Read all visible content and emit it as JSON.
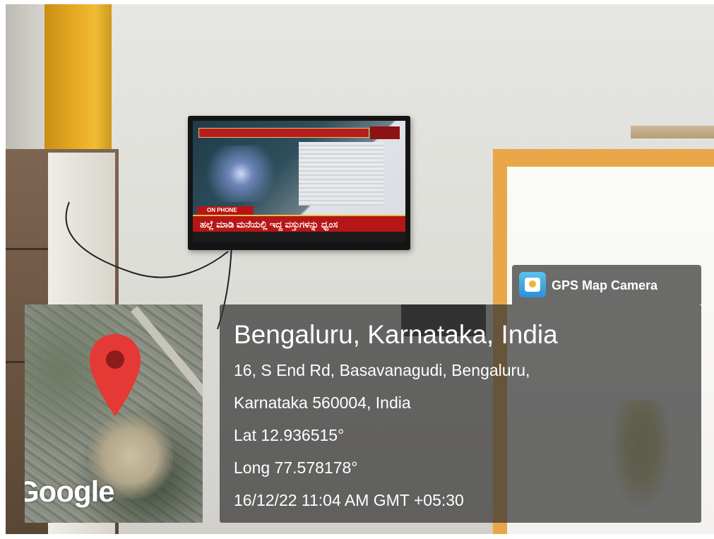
{
  "overlay": {
    "app_name": "GPS Map Camera",
    "app_icon": "gps-map-camera-icon",
    "map_attribution": "Google",
    "location_title": "Bengaluru, Karnataka, India",
    "address_line_1": "16, S End Rd, Basavanagudi, Bengaluru,",
    "address_line_2": "Karnataka 560004, India",
    "latitude": "Lat 12.936515°",
    "longitude": "Long 77.578178°",
    "datetime": "16/12/22 11:04 AM GMT +05:30"
  },
  "scene": {
    "tv_ticker_text": "ಹಲ್ಲೆ ಮಾಡಿ ಮನೆಯಲ್ಲಿ ಇದ್ದ ವಸ್ತುಗಳನ್ನು ಧ್ವಂಸ",
    "tv_caller_label": "ON PHONE",
    "colors": {
      "wall": "#dcdcd7",
      "pillar_yellow": "#e6aa22",
      "window_frame_orange": "#e8a84a",
      "overlay_panel": "#343434",
      "map_pin_red": "#e53935"
    }
  }
}
